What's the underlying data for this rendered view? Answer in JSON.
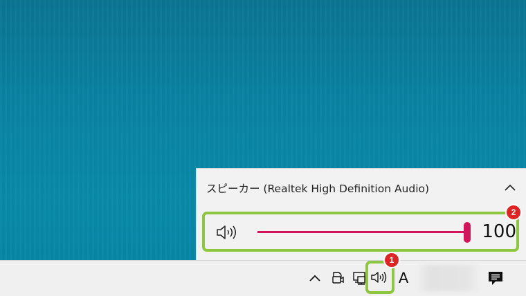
{
  "volume_flyout": {
    "device_name": "スピーカー (Realtek High Definition Audio)",
    "collapse_icon": "chevron-up-icon",
    "speaker_icon": "speaker-icon",
    "volume_value": "100",
    "volume_level": 1.0,
    "accent_color": "#d4145a"
  },
  "taskbar": {
    "tray_icons": [
      "chevron-up-icon",
      "meet-now-icon",
      "network-icon",
      "speaker-icon",
      "ime-icon",
      "clock",
      "notification-icon"
    ],
    "ime_label": "A"
  },
  "annotations": {
    "badge_1": "1",
    "badge_2": "2",
    "highlight_color": "#8dc640"
  }
}
